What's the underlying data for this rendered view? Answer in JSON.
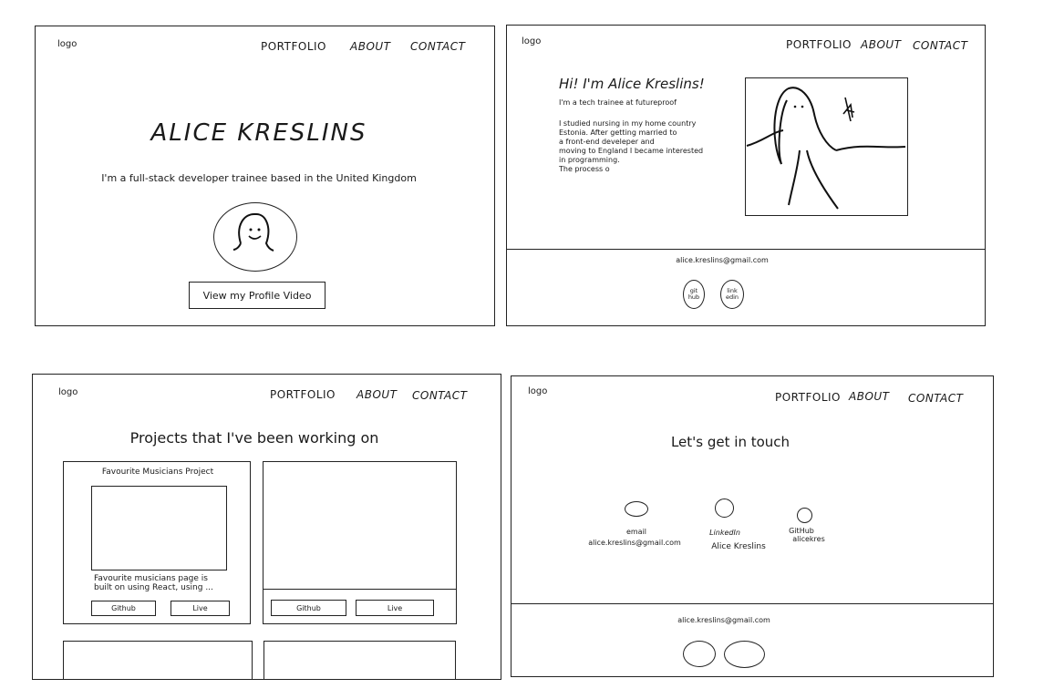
{
  "nav": {
    "logo": "logo",
    "portfolio": "PORTFOLIO",
    "about": "ABOUT",
    "contact": "CONTACT"
  },
  "home": {
    "name": "ALICE KRESLINS",
    "tagline": "I'm a full-stack developer  trainee based in the United Kingdom",
    "video_button": "View my Profile Video"
  },
  "about": {
    "heading": "Hi! I'm Alice Kreslins!",
    "subtitle": "I'm a tech trainee at futureproof",
    "bio_lines": [
      "I studied nursing in my home country",
      "Estonia. After getting married to",
      "a front-end develeper and",
      "moving to England I became interested",
      "in programming.",
      "The process o"
    ],
    "footer_email": "alice.kreslins@gmail.com",
    "icon_github": [
      "git",
      "hub"
    ],
    "icon_linkedin": [
      "link",
      "edin"
    ]
  },
  "projects": {
    "heading": "Projects that I've been working on",
    "card1_title": "Favourite Musicians Project",
    "card1_desc": [
      "Favourite musicians page is",
      "built on using React, using ..."
    ],
    "github_label": "Github",
    "live_label": "Live",
    "github_label_2": "Github",
    "live_label_2": "Live"
  },
  "contact": {
    "heading": "Let's get in touch",
    "email_label": "email",
    "email_value": "alice.kreslins@gmail.com",
    "linkedin_label": "LinkedIn",
    "linkedin_value": "Alice Kreslins",
    "github_label": "GitHub",
    "github_value": "alicekres",
    "footer_email": "alice.kreslins@gmail.com"
  }
}
